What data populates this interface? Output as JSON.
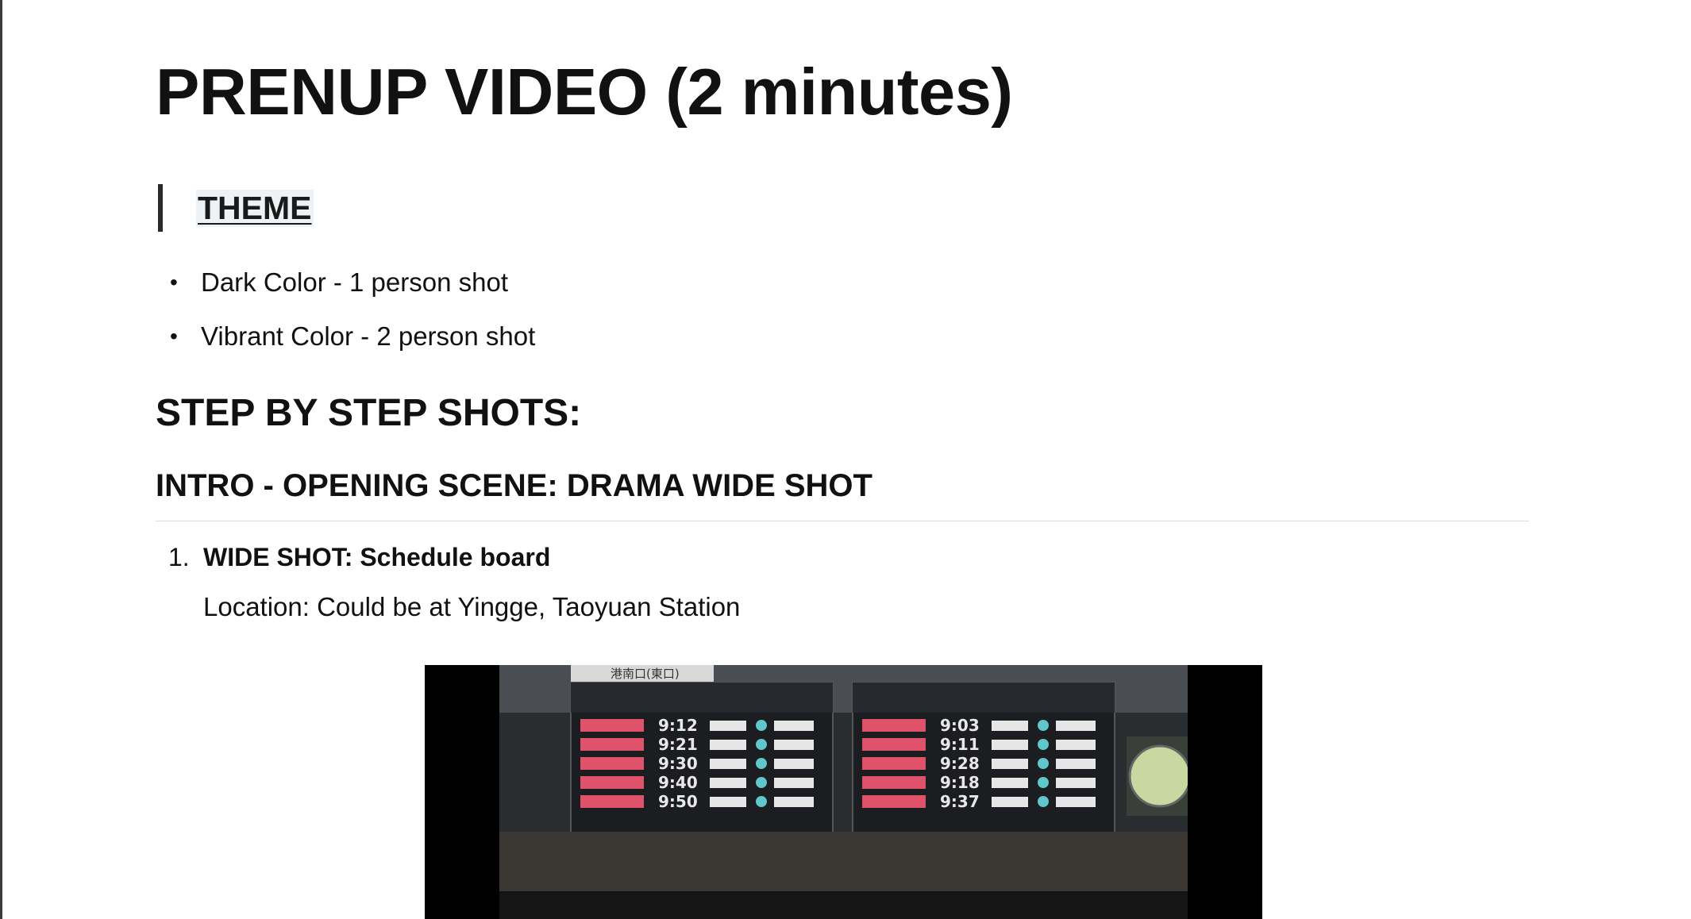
{
  "document": {
    "title": "PRENUP VIDEO (2 minutes)",
    "theme_heading": "THEME",
    "theme_items": [
      "Dark Color - 1 person shot",
      "Vibrant Color - 2 person shot"
    ],
    "step_heading": "STEP BY STEP SHOTS:",
    "intro_heading": "INTRO - OPENING SCENE:  DRAMA WIDE SHOT",
    "shots": [
      {
        "number": "1.",
        "title": "WIDE SHOT: Schedule board",
        "location": "Location: Could be at Yingge, Taoyuan Station"
      }
    ]
  },
  "media": {
    "description_icon": "video-frame",
    "board_sign": "港南口(東口)",
    "left_board_times": [
      "9:12",
      "9:21",
      "9:30",
      "9:40",
      "9:50"
    ],
    "right_board_times": [
      "9:03",
      "9:11",
      "9:28",
      "9:18",
      "9:37"
    ]
  },
  "colors": {
    "text": "#111111",
    "quote_bar": "#2b2b2b",
    "board_red": "#e0526a",
    "board_teal": "#5fc6c9"
  }
}
